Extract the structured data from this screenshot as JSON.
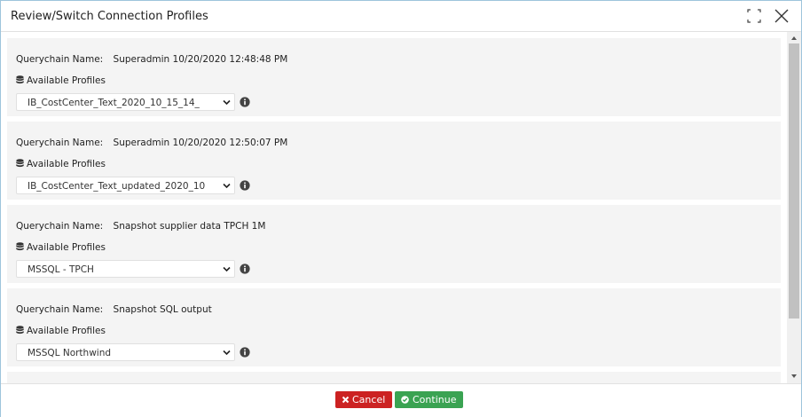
{
  "dialog": {
    "title": "Review/Switch Connection Profiles"
  },
  "profiles": [
    {
      "querychain_label": "Querychain Name:",
      "querychain_name": "Superadmin 10/20/2020 12:48:48 PM",
      "available_label": "Available Profiles",
      "selected_profile": "IB_CostCenter_Text_2020_10_15_14_"
    },
    {
      "querychain_label": "Querychain Name:",
      "querychain_name": "Superadmin 10/20/2020 12:50:07 PM",
      "available_label": "Available Profiles",
      "selected_profile": "IB_CostCenter_Text_updated_2020_10"
    },
    {
      "querychain_label": "Querychain Name:",
      "querychain_name": "Snapshot supplier data TPCH 1M",
      "available_label": "Available Profiles",
      "selected_profile": "MSSQL - TPCH"
    },
    {
      "querychain_label": "Querychain Name:",
      "querychain_name": "Snapshot SQL output",
      "available_label": "Available Profiles",
      "selected_profile": "MSSQL Northwind"
    }
  ],
  "footer": {
    "cancel_label": "Cancel",
    "continue_label": "Continue"
  },
  "icons": {
    "maximize": "maximize-icon",
    "close": "close-icon",
    "database": "database-icon",
    "info": "info-icon",
    "chevron": "chevron-down-icon",
    "cancel": "times-icon",
    "continue": "check-circle-icon"
  },
  "colors": {
    "cancel": "#cc2222",
    "continue": "#3aa352",
    "card_bg": "#f4f4f4",
    "dialog_border": "#9ec4dc"
  }
}
